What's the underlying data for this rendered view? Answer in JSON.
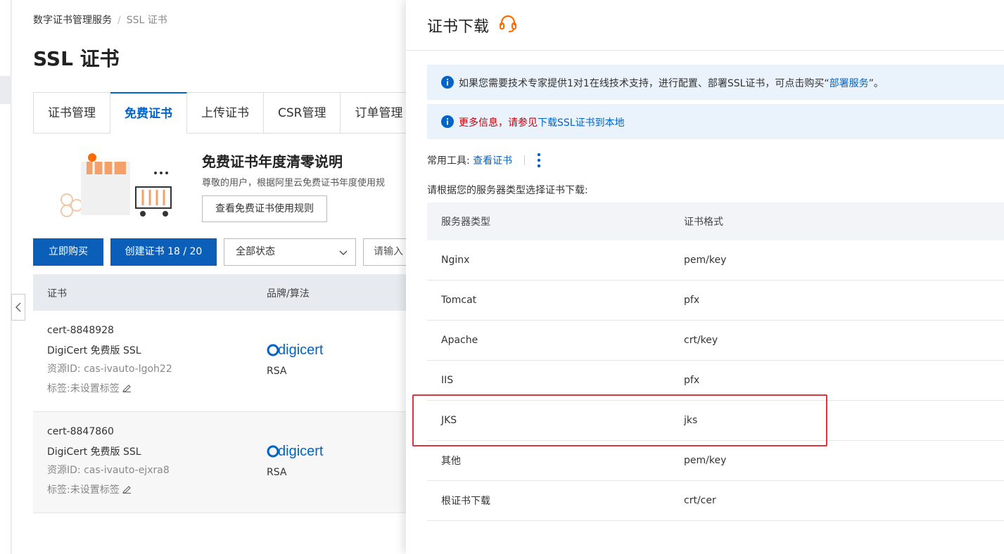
{
  "breadcrumb": {
    "root": "数字证书管理服务",
    "separator": "/",
    "current": "SSL 证书"
  },
  "page_title": "SSL 证书",
  "tabs": [
    {
      "label": "证书管理",
      "active": false
    },
    {
      "label": "免费证书",
      "active": true
    },
    {
      "label": "上传证书",
      "active": false
    },
    {
      "label": "CSR管理",
      "active": false
    },
    {
      "label": "订单管理",
      "active": false
    }
  ],
  "promo": {
    "title": "免费证书年度清零说明",
    "desc": "尊敬的用户，根据阿里云免费证书年度使用规",
    "button": "查看免费证书使用规则"
  },
  "toolbar": {
    "buy": "立即购买",
    "create": "创建证书 18 / 20",
    "status_select": "全部状态",
    "search_placeholder": "请输入"
  },
  "cert_table": {
    "headers": [
      "证书",
      "品牌/算法"
    ],
    "rows": [
      {
        "name": "cert-8848928",
        "product": "DigiCert 免费版 SSL",
        "resource": "资源ID: cas-ivauto-lgoh22",
        "tag": "标签:未设置标签",
        "brand": "digicert",
        "algo": "RSA"
      },
      {
        "name": "cert-8847860",
        "product": "DigiCert 免费版 SSL",
        "resource": "资源ID: cas-ivauto-ejxra8",
        "tag": "标签:未设置标签",
        "brand": "digicert",
        "algo": "RSA"
      }
    ]
  },
  "drawer": {
    "title": "证书下载",
    "notice1": {
      "prefix": "如果您需要技术专家提供1对1在线技术支持，进行配置、部署SSL证书，可点击购买“",
      "link": "部署服务",
      "suffix": "”。"
    },
    "notice2": {
      "red": "更多信息，请参见",
      "link": "下载SSL证书到本地"
    },
    "tools_label": "常用工具:",
    "tools_link": "查看证书",
    "hint": "请根据您的服务器类型选择证书下载:",
    "table": {
      "headers": [
        "服务器类型",
        "证书格式"
      ],
      "rows": [
        {
          "server": "Nginx",
          "format": "pem/key"
        },
        {
          "server": "Tomcat",
          "format": "pfx"
        },
        {
          "server": "Apache",
          "format": "crt/key"
        },
        {
          "server": "IIS",
          "format": "pfx"
        },
        {
          "server": "JKS",
          "format": "jks"
        },
        {
          "server": "其他",
          "format": "pem/key"
        },
        {
          "server": "根证书下载",
          "format": "crt/cer"
        }
      ]
    }
  },
  "colors": {
    "primary": "#0b5fb8",
    "link": "#0064c8",
    "accent_orange": "#ff6a00",
    "highlight_red": "#d9363e",
    "notice_bg": "#eaf2fb"
  }
}
